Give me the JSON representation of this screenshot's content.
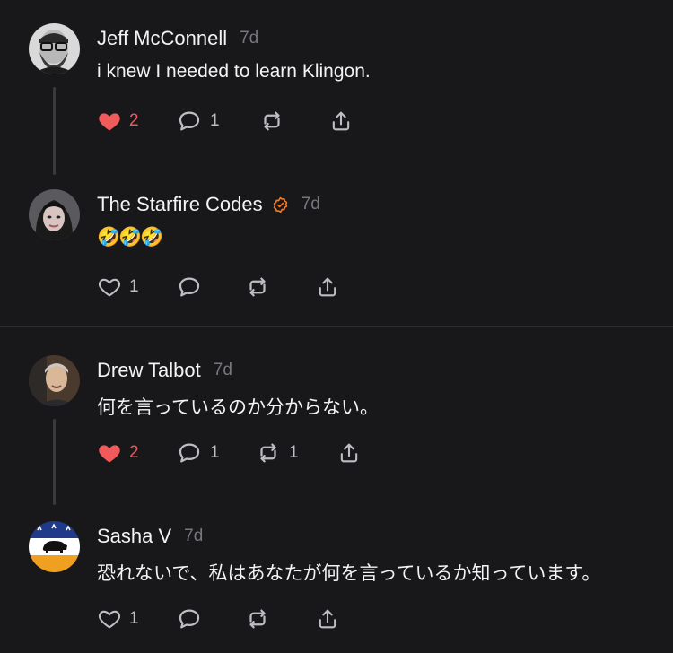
{
  "posts": [
    {
      "author": "Jeff McConnell",
      "time": "7d",
      "text": "i knew I needed to learn Klingon.",
      "likes": "2",
      "liked": true,
      "replies": "1",
      "reposts": ""
    },
    {
      "author": "The Starfire Codes",
      "time": "7d",
      "verified": true,
      "text": "🤣🤣🤣",
      "likes": "1",
      "liked": false,
      "replies": "",
      "reposts": ""
    },
    {
      "author": "Drew Talbot",
      "time": "7d",
      "text": "何を言っているのか分からない。",
      "likes": "2",
      "liked": true,
      "replies": "1",
      "reposts": "1"
    },
    {
      "author": "Sasha V",
      "time": "7d",
      "text": "恐れないで、私はあなたが何を言っているか知っています。",
      "likes": "1",
      "liked": false,
      "replies": "",
      "reposts": ""
    }
  ],
  "colors": {
    "background": "#18181a",
    "liked": "#f05a5a",
    "icon": "#bdbdc2",
    "verified": "#ff7a1a"
  },
  "icons": [
    "heart-icon",
    "reply-icon",
    "repost-icon",
    "share-icon",
    "verified-badge-icon"
  ]
}
